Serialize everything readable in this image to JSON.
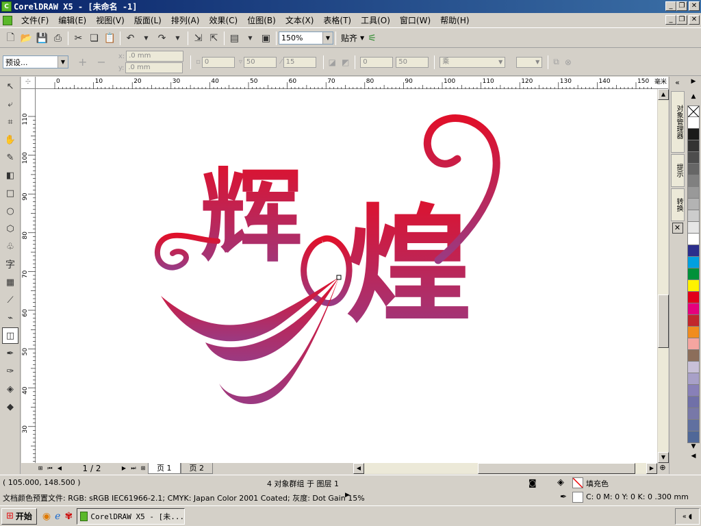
{
  "window": {
    "title": "CorelDRAW X5 - [未命名 -1]",
    "minimize": "_",
    "restore": "❐",
    "close": "✕"
  },
  "menu": [
    "文件(F)",
    "编辑(E)",
    "视图(V)",
    "版面(L)",
    "排列(A)",
    "效果(C)",
    "位图(B)",
    "文本(X)",
    "表格(T)",
    "工具(O)",
    "窗口(W)",
    "帮助(H)"
  ],
  "toolbar": {
    "zoom": "150%",
    "snap_label": "贴齐"
  },
  "propertybar": {
    "preset": "预设...",
    "x_label": "x:",
    "y_label": "y:",
    "x_value": ".0 mm",
    "y_value": ".0 mm",
    "field_a": "0",
    "field_b": "50",
    "field_c": "15",
    "field_d": "0",
    "field_e": "50",
    "blend_mode": "乘"
  },
  "ruler": {
    "top_ticks": [
      "0",
      "10",
      "20",
      "30",
      "40",
      "50",
      "60",
      "70",
      "80",
      "90",
      "100",
      "110",
      "120",
      "130",
      "140",
      "150"
    ],
    "top_unit": "毫米",
    "left_ticks": [
      "110",
      "100",
      "90",
      "80",
      "70",
      "60",
      "50",
      "40",
      "30"
    ]
  },
  "artwork": {
    "char1": "辉",
    "char2": "煌",
    "gradient_top": "#e0102a",
    "gradient_bottom": "#9a3a82"
  },
  "pages": {
    "counter": "1 / 2",
    "tabs": [
      "页 1",
      "页 2"
    ]
  },
  "dockers": [
    "对象管理器",
    "提示",
    "转换"
  ],
  "palette": [
    "#ffffff",
    "#1a1a1a",
    "#333333",
    "#4d4d4d",
    "#666666",
    "#808080",
    "#999999",
    "#b3b3b3",
    "#cccccc",
    "#e6e6e6",
    "#ffffff",
    "#2b2e8c",
    "#00a0e0",
    "#00913a",
    "#fff200",
    "#e2001a",
    "#e5007e",
    "#c1272d",
    "#f08c1e",
    "#f5a5a0",
    "#8c6e5a",
    "#c8c0d8",
    "#a8a0c8",
    "#8880b8",
    "#7070a8",
    "#7878a8",
    "#6070a0",
    "#506898"
  ],
  "status": {
    "coords": "( 105.000, 148.500 )",
    "selection": "4 对象群组 于 图层 1",
    "color_profile": "文档颜色预置文件: RGB: sRGB IEC61966-2.1; CMYK: Japan Color 2001 Coated; 灰度: Dot Gain 15%",
    "fill_label": "填充色",
    "outline": "C: 0 M: 0 Y: 0 K: 0  .300 mm"
  },
  "taskbar": {
    "start": "开始",
    "task": "CorelDRAW X5 - [未..."
  }
}
